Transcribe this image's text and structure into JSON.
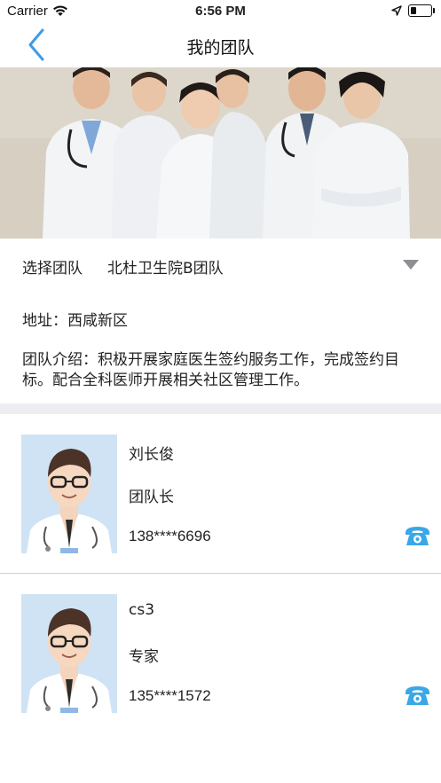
{
  "status_bar": {
    "carrier": "Carrier",
    "time": "6:56 PM",
    "battery_level": 0.3
  },
  "nav": {
    "title": "我的团队",
    "back_icon": "chevron-left-icon",
    "accent_color": "#3d9be9"
  },
  "banner": {
    "image": "doctor-team-photo"
  },
  "team": {
    "select_label": "选择团队",
    "selected_team": "北杜卫生院B团队",
    "caret_icon": "triangle-down-icon",
    "address_label": "地址：",
    "address": "西咸新区",
    "intro_label": "团队介绍：",
    "intro": "积极开展家庭医生签约服务工作，完成签约目标。配合全科医师开展相关社区管理工作。"
  },
  "members": [
    {
      "name": "刘长俊",
      "role": "团队长",
      "phone": "138****6696",
      "call_icon": "phone-icon"
    },
    {
      "name": "cs3",
      "role": "专家",
      "phone": "135****1572",
      "call_icon": "phone-icon"
    }
  ],
  "colors": {
    "accent": "#3d9be9",
    "call_icon": "#3aa7e6",
    "section_gap": "#ededf2",
    "caret": "#8e8e93"
  }
}
